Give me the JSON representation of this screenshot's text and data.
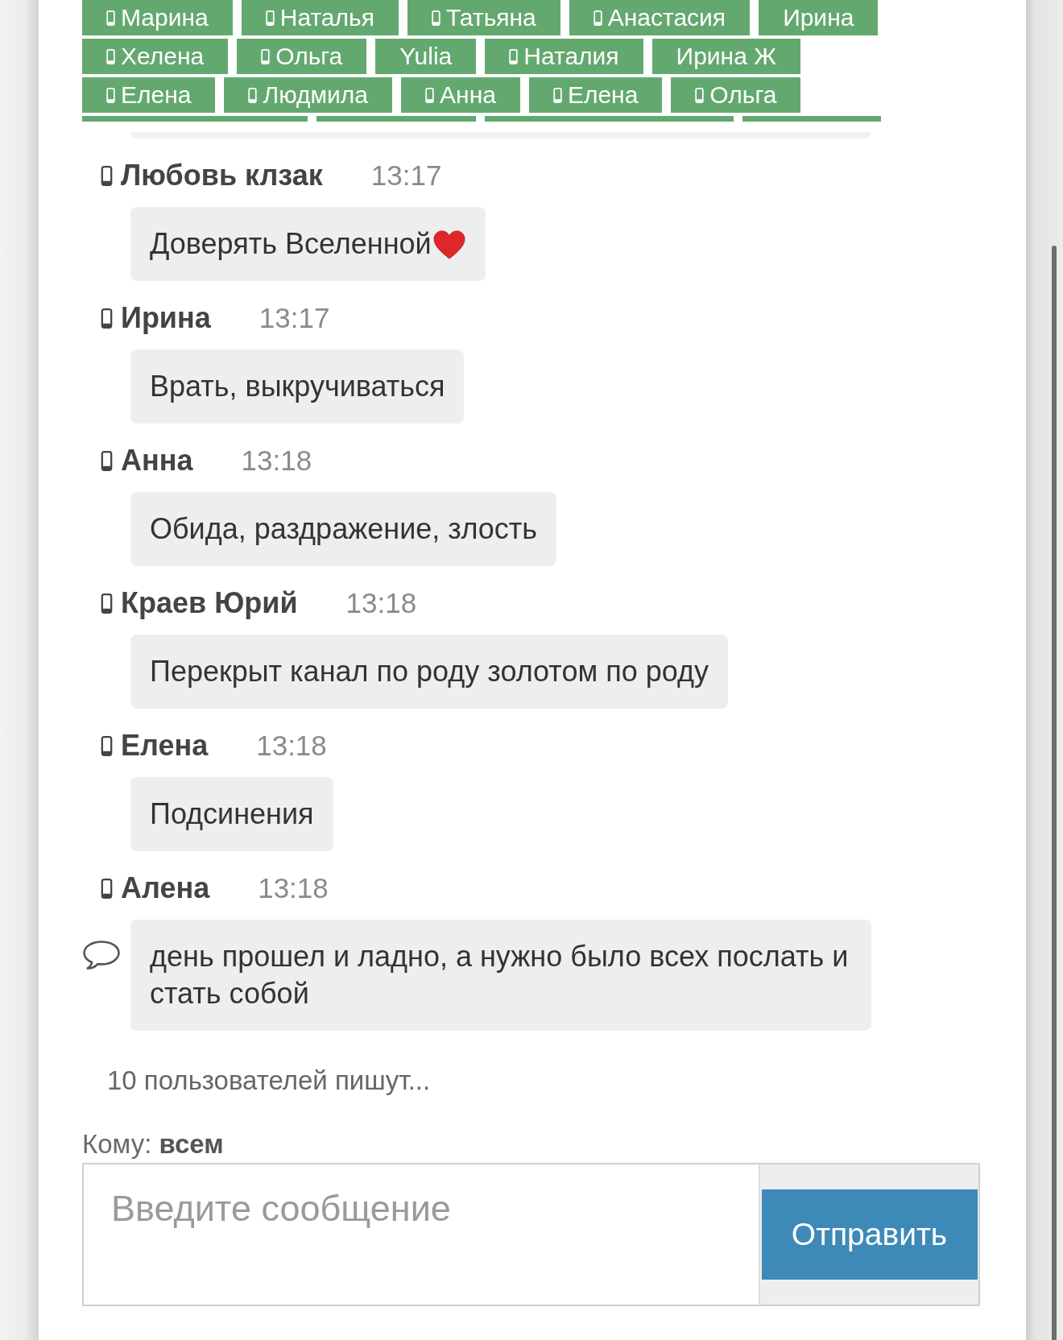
{
  "user_tags": {
    "rows": [
      {
        "users": [
          {
            "kind": "tag",
            "name": "Марина",
            "mobile": true
          },
          {
            "kind": "tag",
            "name": "Наталья",
            "mobile": true
          },
          {
            "kind": "tag",
            "name": "Татьяна",
            "mobile": true
          },
          {
            "kind": "tag",
            "name": "Анастасия",
            "mobile": true
          },
          {
            "kind": "tag",
            "name": "Ирина",
            "mobile": false
          }
        ]
      },
      {
        "users": [
          {
            "kind": "tag",
            "name": "Хелена",
            "mobile": true
          },
          {
            "kind": "tag",
            "name": "Ольга",
            "mobile": true
          },
          {
            "kind": "tag",
            "name": "Yulia",
            "mobile": false
          },
          {
            "kind": "tag",
            "name": "Наталия",
            "mobile": true
          },
          {
            "kind": "tag",
            "name": "Ирина Ж",
            "mobile": false
          }
        ]
      },
      {
        "users": [
          {
            "kind": "tag",
            "name": "Елена",
            "mobile": true
          },
          {
            "kind": "tag",
            "name": "Людмила",
            "mobile": true
          },
          {
            "kind": "tag",
            "name": "Анна",
            "mobile": true
          },
          {
            "kind": "tag",
            "name": "Елена",
            "mobile": true
          },
          {
            "kind": "tag",
            "name": "Ольга",
            "mobile": true
          }
        ]
      },
      {
        "users": [
          {
            "kind": "cut"
          },
          {
            "kind": "cut"
          },
          {
            "kind": "cut"
          },
          {
            "kind": "cut"
          }
        ]
      }
    ]
  },
  "messages": [
    {
      "kind": "cut"
    },
    {
      "kind": "message",
      "author": "Любовь клзак",
      "mobile": true,
      "time": "13:17",
      "text": "Доверять Вселенной",
      "emoji": true,
      "comment_icon": false
    },
    {
      "kind": "message",
      "author": "Ирина",
      "mobile": true,
      "time": "13:17",
      "text": "Врать, выкручиваться",
      "emoji": false,
      "comment_icon": false
    },
    {
      "kind": "message",
      "author": "Анна",
      "mobile": true,
      "time": "13:18",
      "text": "Обида, раздражение, злость",
      "emoji": false,
      "comment_icon": false
    },
    {
      "kind": "message",
      "author": "Краев Юрий",
      "mobile": true,
      "time": "13:18",
      "text": "Перекрыт канал по роду золотом по роду",
      "emoji": false,
      "comment_icon": false
    },
    {
      "kind": "message",
      "author": "Елена",
      "mobile": true,
      "time": "13:18",
      "text": "Подсинения",
      "emoji": false,
      "comment_icon": false
    },
    {
      "kind": "message",
      "author": "Алена",
      "mobile": true,
      "time": "13:18",
      "text": "день прошел и ладно, а нужно было всех послать и стать собой",
      "emoji": false,
      "comment_icon": true
    }
  ],
  "typing": "10 пользователей пишут...",
  "recipient": "Кому: **всем**",
  "composer": {
    "placeholder": "Введите сообщение",
    "send_button": "Отправить"
  }
}
